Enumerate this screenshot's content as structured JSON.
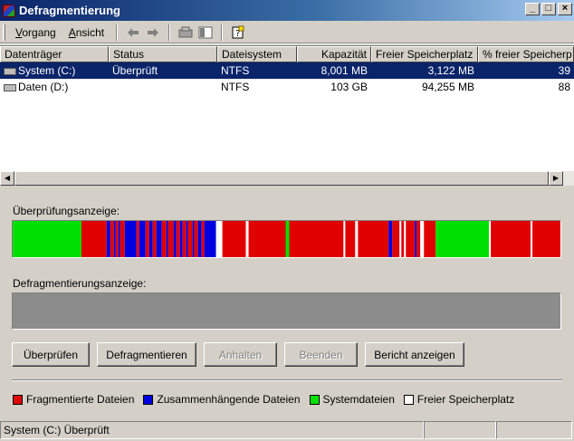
{
  "window": {
    "title": "Defragmentierung",
    "buttons": [
      "_",
      "□",
      "×"
    ]
  },
  "menu": {
    "items": [
      "Vorgang",
      "Ansicht"
    ]
  },
  "toolbar": {
    "icons": [
      "back-arrow",
      "forward-arrow",
      "disk-props",
      "view-toggle",
      "help"
    ]
  },
  "volumes": {
    "columns": [
      "Datenträger",
      "Status",
      "Dateisystem",
      "Kapazität",
      "Freier Speicherplatz",
      "% freier Speicherp"
    ],
    "rows": [
      {
        "name": "System (C:)",
        "status": "Überprüft",
        "fs": "NTFS",
        "capacity": "8,001 MB",
        "free": "3,122 MB",
        "pct": "39",
        "selected": true
      },
      {
        "name": "Daten (D:)",
        "status": "",
        "fs": "NTFS",
        "capacity": "103 GB",
        "free": "94,255 MB",
        "pct": "88",
        "selected": false
      }
    ]
  },
  "analysis": {
    "label": "Überprüfungsanzeige:",
    "segments": [
      [
        "g",
        0,
        76
      ],
      [
        "r",
        76,
        104
      ],
      [
        "b",
        104,
        108
      ],
      [
        "r",
        108,
        112
      ],
      [
        "b",
        112,
        114
      ],
      [
        "r",
        114,
        117
      ],
      [
        "b",
        117,
        119
      ],
      [
        "r",
        119,
        124
      ],
      [
        "b",
        124,
        137
      ],
      [
        "r",
        137,
        140
      ],
      [
        "b",
        140,
        147
      ],
      [
        "r",
        147,
        151
      ],
      [
        "b",
        151,
        155
      ],
      [
        "r",
        155,
        159
      ],
      [
        "b",
        159,
        165
      ],
      [
        "r",
        165,
        170
      ],
      [
        "b",
        170,
        172
      ],
      [
        "r",
        172,
        178
      ],
      [
        "b",
        178,
        181
      ],
      [
        "r",
        181,
        185
      ],
      [
        "b",
        185,
        188
      ],
      [
        "r",
        188,
        192
      ],
      [
        "b",
        192,
        194
      ],
      [
        "r",
        194,
        199
      ],
      [
        "b",
        199,
        201
      ],
      [
        "r",
        201,
        205
      ],
      [
        "b",
        205,
        209
      ],
      [
        "r",
        209,
        212
      ],
      [
        "b",
        212,
        225
      ],
      [
        "w",
        225,
        232
      ],
      [
        "r",
        232,
        258
      ],
      [
        "w",
        258,
        261
      ],
      [
        "r",
        261,
        302
      ],
      [
        "g",
        302,
        306
      ],
      [
        "r",
        306,
        366
      ],
      [
        "w",
        366,
        368
      ],
      [
        "r",
        368,
        379
      ],
      [
        "w",
        379,
        382
      ],
      [
        "r",
        382,
        416
      ],
      [
        "b",
        416,
        420
      ],
      [
        "r",
        420,
        428
      ],
      [
        "w",
        428,
        430
      ],
      [
        "r",
        430,
        433
      ],
      [
        "w",
        433,
        435
      ],
      [
        "r",
        435,
        445
      ],
      [
        "b",
        445,
        447
      ],
      [
        "r",
        447,
        451
      ],
      [
        "w",
        451,
        455
      ],
      [
        "r",
        455,
        468
      ],
      [
        "g",
        468,
        527
      ],
      [
        "w",
        527,
        529
      ],
      [
        "r",
        529,
        573
      ],
      [
        "w",
        573,
        575
      ],
      [
        "r",
        575,
        606
      ]
    ],
    "colors": {
      "r": "#e00000",
      "b": "#0000e0",
      "g": "#00e000",
      "w": "#ffffff"
    }
  },
  "defrag": {
    "label": "Defragmentierungsanzeige:"
  },
  "buttons": [
    {
      "label": "Überprüfen",
      "enabled": true
    },
    {
      "label": "Defragmentieren",
      "enabled": true
    },
    {
      "label": "Anhalten",
      "enabled": false
    },
    {
      "label": "Beenden",
      "enabled": false
    },
    {
      "label": "Bericht anzeigen",
      "enabled": true
    }
  ],
  "legend": [
    {
      "label": "Fragmentierte Dateien",
      "color": "#e00000"
    },
    {
      "label": "Zusammenhängende Dateien",
      "color": "#0000e0"
    },
    {
      "label": "Systemdateien",
      "color": "#00e000"
    },
    {
      "label": "Freier Speicherplatz",
      "color": "#ffffff"
    }
  ],
  "status": {
    "text": "System (C:) Überprüft"
  }
}
